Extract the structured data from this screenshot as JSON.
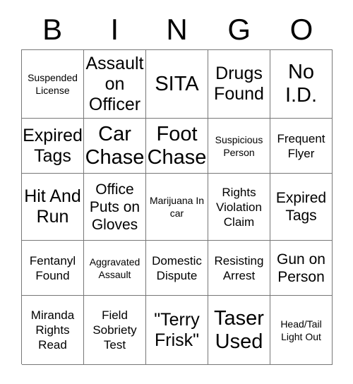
{
  "header": {
    "letters": [
      "B",
      "I",
      "N",
      "G",
      "O"
    ]
  },
  "grid": {
    "columns": 5,
    "rows": 5,
    "border_color": "#777777",
    "text_color": "#000000",
    "background_color": "#ffffff",
    "cells": [
      {
        "text": "Suspended License",
        "size": "fs-s"
      },
      {
        "text": "Assault on Officer",
        "size": "fs-xl"
      },
      {
        "text": "SITA",
        "size": "fs-xxl"
      },
      {
        "text": "Drugs Found",
        "size": "fs-xl"
      },
      {
        "text": "No I.D.",
        "size": "fs-xxl"
      },
      {
        "text": "Expired Tags",
        "size": "fs-xl"
      },
      {
        "text": "Car Chase",
        "size": "fs-xxl"
      },
      {
        "text": "Foot Chase",
        "size": "fs-xxl"
      },
      {
        "text": "Suspicious Person",
        "size": "fs-s"
      },
      {
        "text": "Frequent Flyer",
        "size": "fs-m"
      },
      {
        "text": "Hit And Run",
        "size": "fs-xl"
      },
      {
        "text": "Office Puts on Gloves",
        "size": "fs-l"
      },
      {
        "text": "Marijuana In car",
        "size": "fs-s"
      },
      {
        "text": "Rights Violation Claim",
        "size": "fs-m"
      },
      {
        "text": "Expired Tags",
        "size": "fs-l"
      },
      {
        "text": "Fentanyl Found",
        "size": "fs-m"
      },
      {
        "text": "Aggravated Assault",
        "size": "fs-s"
      },
      {
        "text": "Domestic Dispute",
        "size": "fs-m"
      },
      {
        "text": "Resisting Arrest",
        "size": "fs-m"
      },
      {
        "text": "Gun on Person",
        "size": "fs-l"
      },
      {
        "text": "Miranda Rights Read",
        "size": "fs-m"
      },
      {
        "text": "Field Sobriety Test",
        "size": "fs-m"
      },
      {
        "text": "\"Terry Frisk\"",
        "size": "fs-xl"
      },
      {
        "text": "Taser Used",
        "size": "fs-xxl"
      },
      {
        "text": "Head/Tail Light Out",
        "size": "fs-s"
      }
    ]
  }
}
